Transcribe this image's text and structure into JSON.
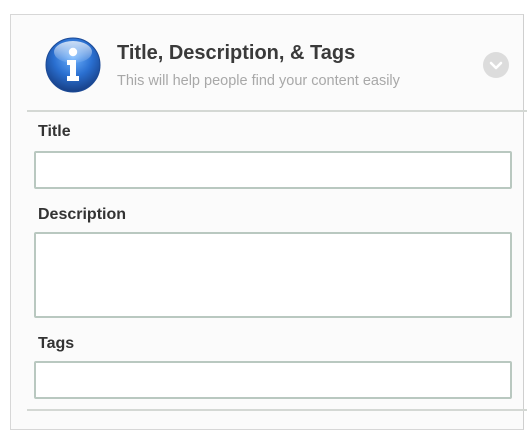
{
  "header": {
    "title": "Title, Description, & Tags",
    "subtitle": "This will help people find your content easily",
    "info_icon": "info-icon",
    "collapse_icon": "chevron-down-icon"
  },
  "fields": {
    "title": {
      "label": "Title",
      "value": ""
    },
    "description": {
      "label": "Description",
      "value": ""
    },
    "tags": {
      "label": "Tags",
      "value": ""
    }
  },
  "colors": {
    "icon_blue": "#2a6fd0",
    "label": "#333333",
    "subtitle": "#a8a8a8",
    "input_border": "#b9c8c0"
  }
}
